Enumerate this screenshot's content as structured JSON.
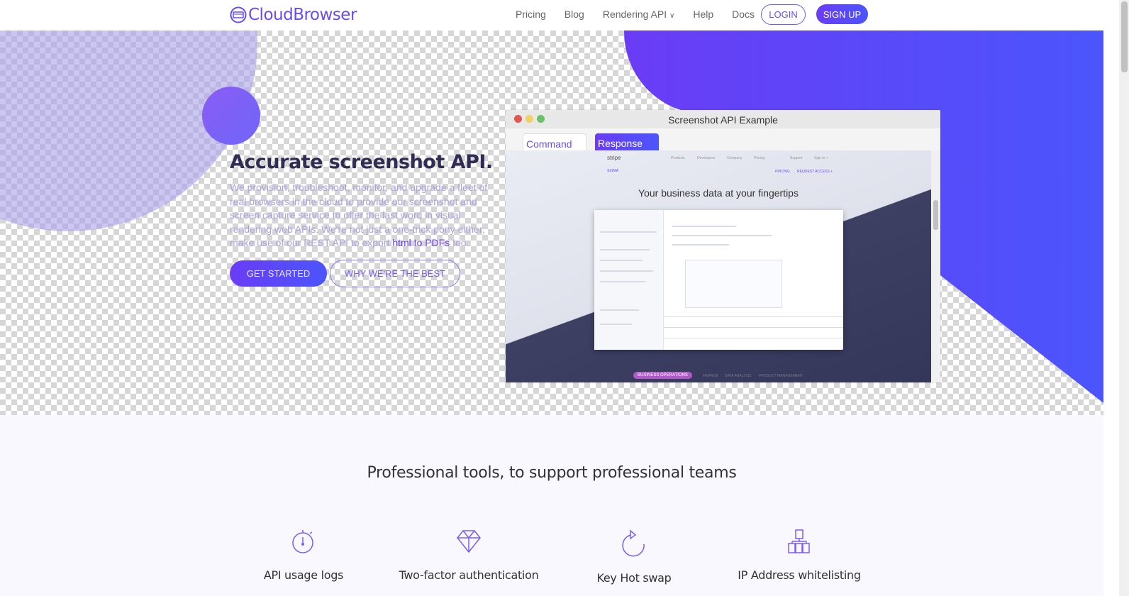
{
  "nav": {
    "brand": "CloudBrowser",
    "links": [
      "Pricing",
      "Blog",
      "Rendering API",
      "Help",
      "Docs"
    ],
    "login": "LOGIN",
    "signup": "SIGN UP"
  },
  "hero": {
    "title": "Accurate screenshot API.",
    "desc_before": "We provision, troubleshoot, monitor, and upgrade a fleet of real browsers in the cloud to provide our screenshot and screen capture service to offer the last word in visual rendering web APIs. We're not just a one-trick pony either, make use of our REST API to export ",
    "desc_link": "html to PDFs",
    "desc_after": " too.",
    "cta_primary": "GET STARTED",
    "cta_secondary": "WHY WE'RE THE BEST"
  },
  "window": {
    "title": "Screenshot API Example",
    "tabs": [
      "Command",
      "Response"
    ],
    "shot": {
      "brand": "stripe",
      "nav": [
        "Products",
        "Developers",
        "Company",
        "Pricing",
        "Support",
        "Sign in +"
      ],
      "product": "SIGMA",
      "subnav": [
        "PRICING",
        "REQUEST ACCESS +"
      ],
      "headline": "Your business data at your fingertips",
      "pills": [
        "BUSINESS OPERATIONS",
        "FINANCE",
        "DATA ANALYSIS",
        "PRODUCT MANAGEMENT"
      ]
    }
  },
  "features": {
    "title": "Professional tools, to support professional teams",
    "items": [
      {
        "label": "API usage logs",
        "icon": "stopwatch-icon"
      },
      {
        "label": "Two-factor authentication",
        "icon": "diamond-icon"
      },
      {
        "label": "Key Hot swap",
        "icon": "refresh-icon"
      },
      {
        "label": "IP Address whitelisting",
        "icon": "network-icon"
      }
    ]
  },
  "colors": {
    "accent": "#6a3cf5",
    "accent2": "#4b55fb",
    "heading": "#2f2d55"
  }
}
